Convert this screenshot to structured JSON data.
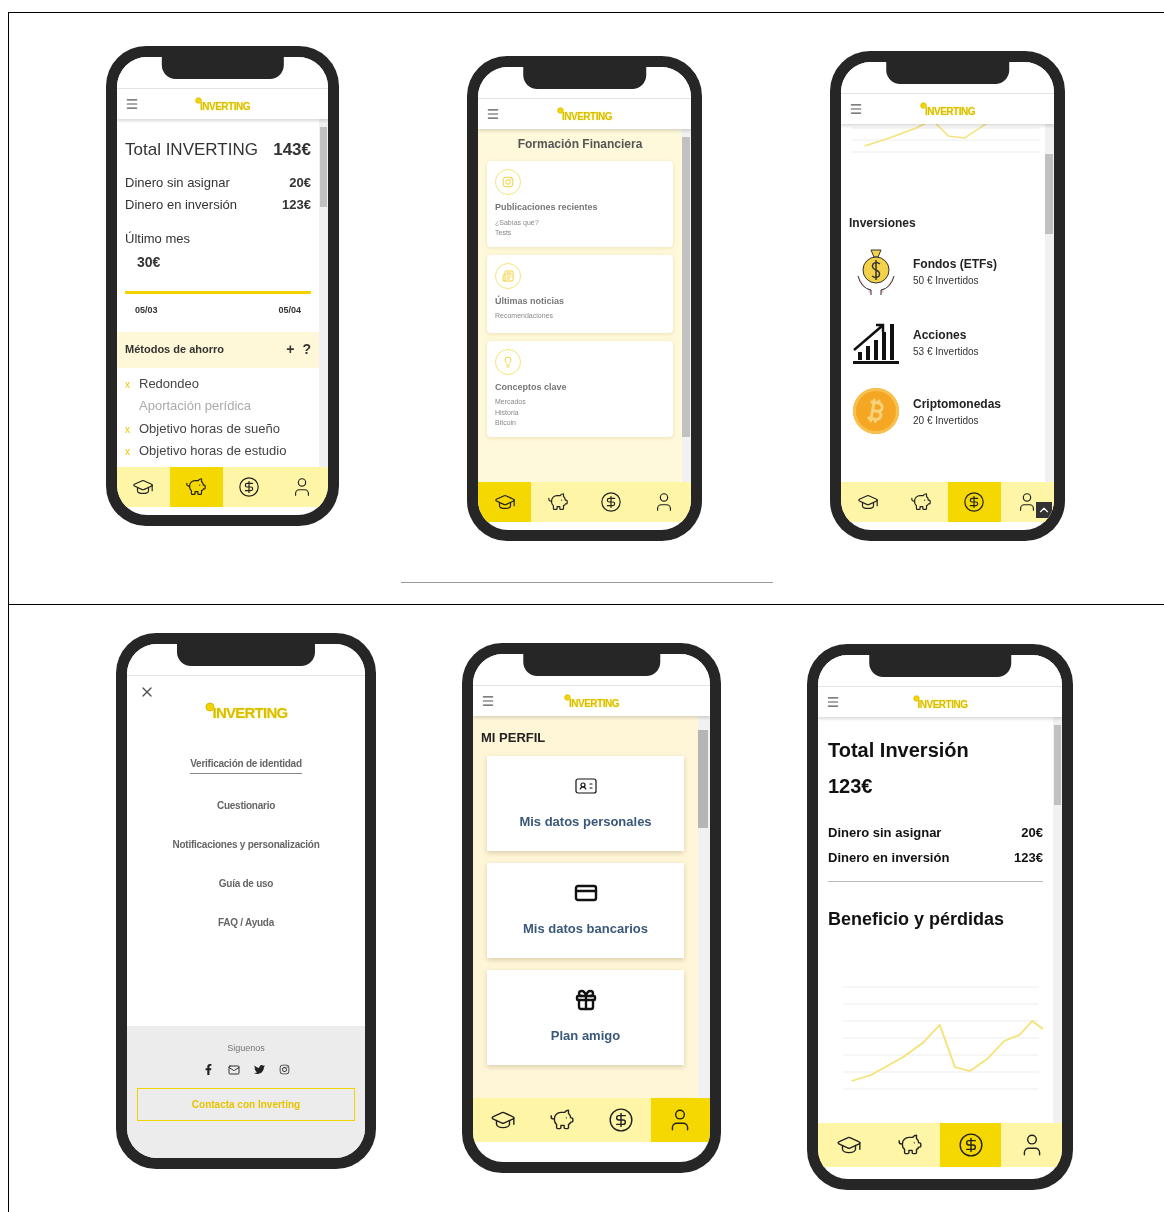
{
  "screens": [
    {
      "kind": "savings",
      "logo": "INVERTING",
      "total_label": "Total INVERTING",
      "total_value": "143€",
      "rows": [
        {
          "label": "Dinero sin asignar",
          "value": "20€"
        },
        {
          "label": "Dinero en inversión",
          "value": "123€"
        }
      ],
      "last_month_label": "Último mes",
      "last_month_value": "30€",
      "progress": {
        "level": 1,
        "start": "05/03",
        "end": "05/04"
      },
      "methods_title": "Métodos de ahorro",
      "methods_actions": [
        "+",
        "?"
      ],
      "methods": [
        {
          "label": "Redondeo",
          "active": true,
          "marker": "x"
        },
        {
          "label": "Aportación perídica",
          "active": false
        },
        {
          "label": "Objetivo horas de sueño",
          "active": true,
          "marker": "x"
        },
        {
          "label": "Objetivo horas de estudio",
          "active": true,
          "marker": "x"
        }
      ],
      "nav": [
        {
          "kind": "learn",
          "selected": false
        },
        {
          "kind": "save",
          "selected": true
        },
        {
          "kind": "invest",
          "selected": false
        },
        {
          "kind": "profile",
          "selected": false
        }
      ]
    },
    {
      "kind": "learning",
      "logo": "INVERTING",
      "title": "Formación Financiera",
      "cards": [
        {
          "kind": "social",
          "title": "Publicaciones recientes",
          "lines": [
            "¿Sabías qué?",
            "Tests"
          ]
        },
        {
          "kind": "news",
          "title": "Últimas noticias",
          "lines": [
            "Recomendaciones"
          ]
        },
        {
          "kind": "concepts",
          "title": "Conceptos clave",
          "lines": [
            "Mercados",
            "Historia",
            "Bitcoin"
          ]
        }
      ],
      "nav": [
        {
          "kind": "learn",
          "selected": true
        },
        {
          "kind": "save",
          "selected": false
        },
        {
          "kind": "invest",
          "selected": false
        },
        {
          "kind": "profile",
          "selected": false
        }
      ]
    },
    {
      "kind": "investments",
      "logo": "INVERTING",
      "title": "Inversiones",
      "items": [
        {
          "kind": "funds",
          "name": "Fondos (ETFs)",
          "amount": "50 € Invertidos"
        },
        {
          "kind": "stocks",
          "name": "Acciones",
          "amount": "53 € Invertidos"
        },
        {
          "kind": "crypto",
          "name": "Criptomonedas",
          "amount": "20 € Invertidos"
        }
      ],
      "scroll_top": true,
      "nav": [
        {
          "kind": "learn",
          "selected": false
        },
        {
          "kind": "save",
          "selected": false
        },
        {
          "kind": "invest",
          "selected": true
        },
        {
          "kind": "profile",
          "selected": false
        }
      ]
    },
    {
      "kind": "menu",
      "logo": "INVERTING",
      "items": [
        {
          "label": "Verificación de identidad",
          "selected": true
        },
        {
          "label": "Cuestionario",
          "selected": false
        },
        {
          "label": "Notificaciones y personalización",
          "selected": false
        },
        {
          "label": "Guía de uso",
          "selected": false
        },
        {
          "label": "FAQ / Ayuda",
          "selected": false
        }
      ],
      "follow_label": "Siguenos",
      "contact_button": "Contacta con Inverting"
    },
    {
      "kind": "profile",
      "logo": "INVERTING",
      "title": "MI PERFIL",
      "cards": [
        {
          "kind": "personal",
          "label": "Mis datos personales"
        },
        {
          "kind": "bank",
          "label": "Mis datos bancarios"
        },
        {
          "kind": "gift",
          "label": "Plan amigo"
        }
      ],
      "nav": [
        {
          "kind": "learn",
          "selected": false
        },
        {
          "kind": "save",
          "selected": false
        },
        {
          "kind": "invest",
          "selected": false
        },
        {
          "kind": "profile",
          "selected": true
        }
      ]
    },
    {
      "kind": "portfolio",
      "logo": "INVERTING",
      "title": "Total Inversión",
      "total": "123€",
      "rows": [
        {
          "label": "Dinero sin asignar",
          "value": "20€"
        },
        {
          "label": "Dinero en inversión",
          "value": "123€"
        }
      ],
      "chart_title": "Beneficio y pérdidas",
      "nav": [
        {
          "kind": "learn",
          "selected": false
        },
        {
          "kind": "save",
          "selected": false
        },
        {
          "kind": "invest",
          "selected": true
        },
        {
          "kind": "profile",
          "selected": false
        }
      ]
    }
  ]
}
